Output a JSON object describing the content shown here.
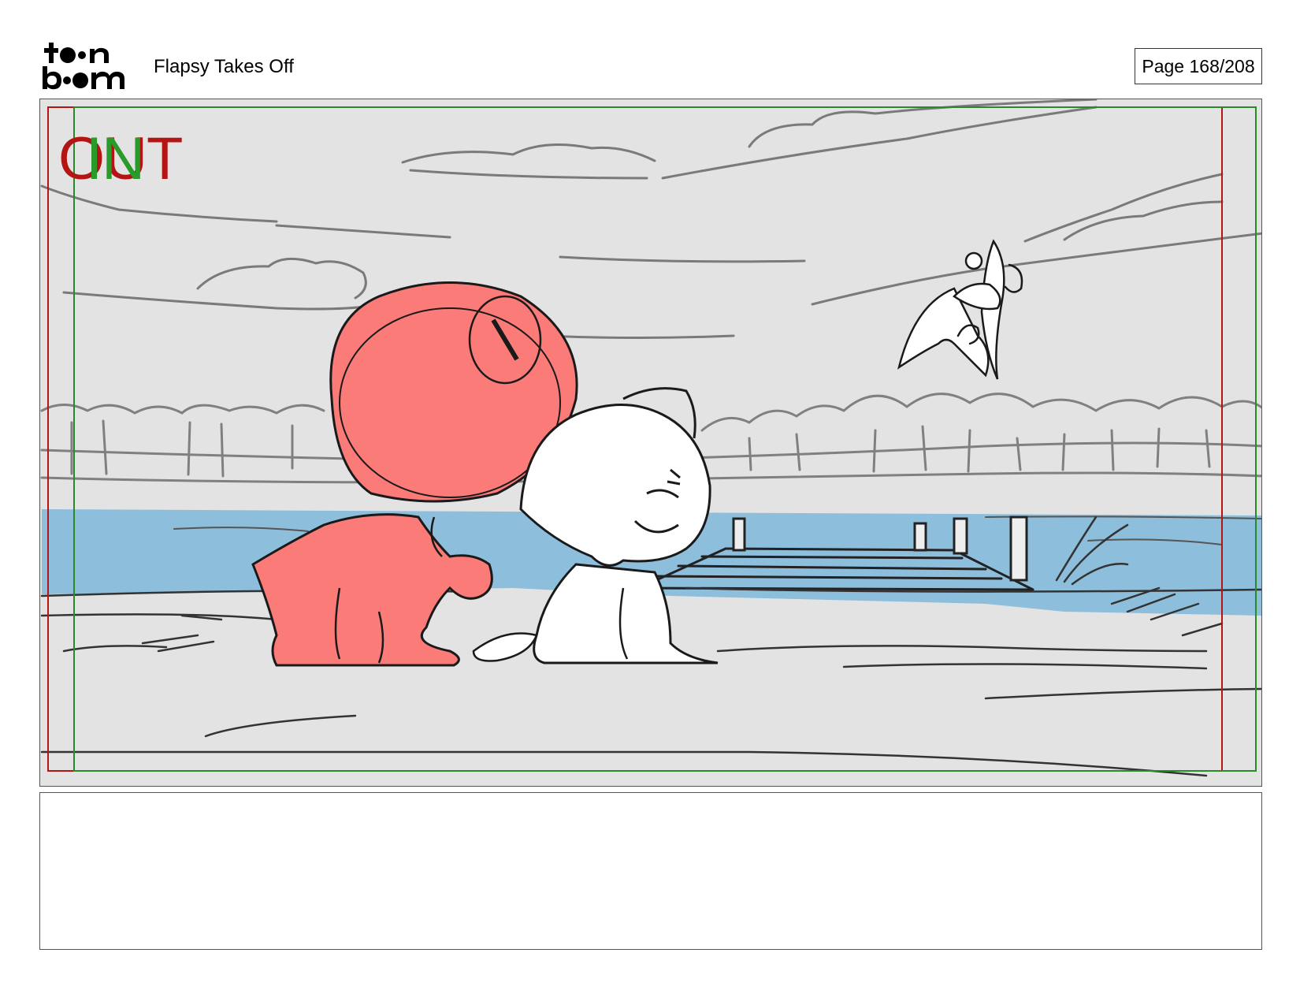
{
  "header": {
    "logo_line1": "toon",
    "logo_line2": "boom",
    "title": "Flapsy Takes Off",
    "page_label": "Page 168/208"
  },
  "panel": {
    "out_marker": "OUT",
    "in_marker": "IN"
  },
  "notes": {
    "text": ""
  },
  "colors": {
    "safe_frame_red": "#b41414",
    "safe_frame_green": "#2a8a2a",
    "sky_bg": "#e3e3e3",
    "water": "#8dbedc",
    "red_character": "#fa7b78"
  }
}
